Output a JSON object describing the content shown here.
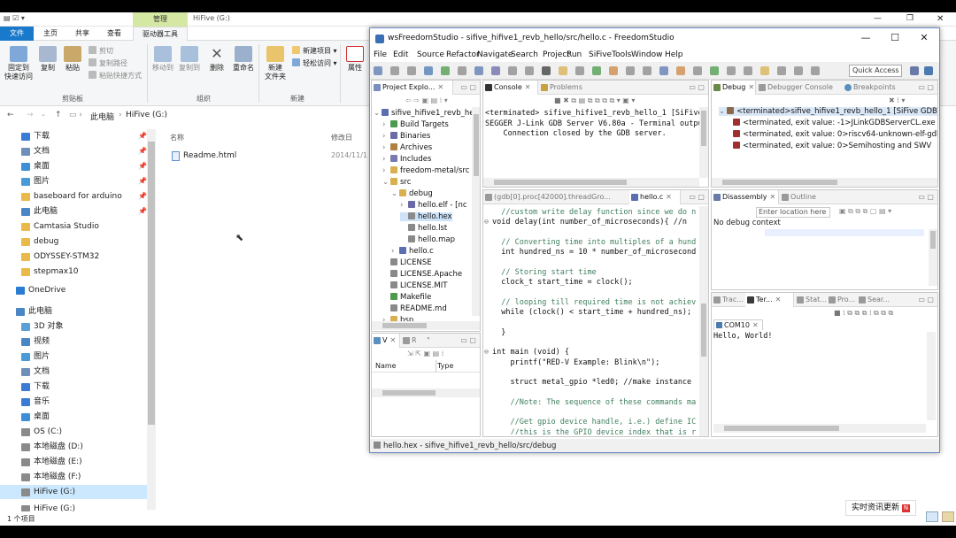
{
  "explorer": {
    "title": "HiFive (G:)",
    "manage_tab": "管理",
    "tabs": [
      "文件",
      "主页",
      "共享",
      "查看",
      "驱动器工具"
    ],
    "ribbon": {
      "pin": "固定到\n快速访问",
      "copy": "复制",
      "paste": "粘贴",
      "cut": "剪切",
      "copy_path": "复制路径",
      "paste_shortcut": "粘贴快捷方式",
      "clipboard_group": "剪贴板",
      "move_to": "移动到",
      "copy_to": "复制到",
      "delete": "删除",
      "rename": "重命名",
      "organize_group": "组织",
      "new_folder": "新建\n文件夹",
      "new_item": "新建项目",
      "easy_access": "轻松访问",
      "new_group": "新建",
      "properties": "属性"
    },
    "address": {
      "pc": "此电脑",
      "drive": "HiFive (G:)"
    },
    "columns": {
      "name": "名称",
      "modified": "修改日"
    },
    "files": [
      {
        "name": "Readme.html",
        "date": "2014/11/1"
      }
    ],
    "nav": [
      {
        "label": "下载",
        "pin": true,
        "color": "#3a7bd5"
      },
      {
        "label": "文档",
        "pin": true,
        "color": "#6e8fb8"
      },
      {
        "label": "桌面",
        "pin": true,
        "color": "#3c8fd6"
      },
      {
        "label": "图片",
        "pin": true,
        "color": "#4b9ad8"
      },
      {
        "label": "baseboard for arduino",
        "pin": true,
        "color": "#e9b949"
      },
      {
        "label": "此电脑",
        "pin": true,
        "color": "#4a86c5"
      },
      {
        "label": "Camtasia Studio",
        "pin": false,
        "color": "#e9b949"
      },
      {
        "label": "debug",
        "pin": false,
        "color": "#e9b949"
      },
      {
        "label": "ODYSSEY-STM32",
        "pin": false,
        "color": "#e9b949"
      },
      {
        "label": "stepmax10",
        "pin": false,
        "color": "#e9b949"
      },
      {
        "label": "OneDrive",
        "pin": false,
        "color": "#2b7cd3"
      },
      {
        "label": "此电脑",
        "pin": false,
        "color": "#4a86c5"
      },
      {
        "label": "3D 对象",
        "pin": false,
        "color": "#5aa0d8"
      },
      {
        "label": "视频",
        "pin": false,
        "color": "#4a86c5"
      },
      {
        "label": "图片",
        "pin": false,
        "color": "#4b9ad8"
      },
      {
        "label": "文档",
        "pin": false,
        "color": "#6e8fb8"
      },
      {
        "label": "下载",
        "pin": false,
        "color": "#3a7bd5"
      },
      {
        "label": "音乐",
        "pin": false,
        "color": "#3a7bd5"
      },
      {
        "label": "桌面",
        "pin": false,
        "color": "#3c8fd6"
      },
      {
        "label": "OS (C:)",
        "pin": false,
        "color": "#8a8a8a"
      },
      {
        "label": "本地磁盘 (D:)",
        "pin": false,
        "color": "#8a8a8a"
      },
      {
        "label": "本地磁盘 (E:)",
        "pin": false,
        "color": "#8a8a8a"
      },
      {
        "label": "本地磁盘 (F:)",
        "pin": false,
        "color": "#8a8a8a"
      },
      {
        "label": "HiFive (G:)",
        "pin": false,
        "color": "#8a8a8a",
        "selected": true
      },
      {
        "label": "HiFive (G:)",
        "pin": false,
        "color": "#8a8a8a"
      }
    ],
    "status": "1 个项目"
  },
  "eclipse": {
    "title": "wsFreedomStudio - sifive_hifive1_revb_hello/src/hello.c - FreedomStudio",
    "menu": [
      "File",
      "Edit",
      "Source",
      "Refactor",
      "Navigate",
      "Search",
      "Project",
      "Run",
      "SiFiveTools",
      "Window",
      "Help"
    ],
    "quick_access": "Quick Access",
    "project_explorer": {
      "tab": "Project Explo...",
      "items": [
        {
          "label": "sifive_hifive1_revb_he",
          "indent": 0,
          "arrow": "⌄",
          "color": "#5b6fb0"
        },
        {
          "label": "Build Targets",
          "indent": 1,
          "arrow": "›",
          "color": "#4c9a4c"
        },
        {
          "label": "Binaries",
          "indent": 1,
          "arrow": "›",
          "color": "#6a6aa8"
        },
        {
          "label": "Archives",
          "indent": 1,
          "arrow": "›",
          "color": "#b08040"
        },
        {
          "label": "Includes",
          "indent": 1,
          "arrow": "›",
          "color": "#7a7ab0"
        },
        {
          "label": "freedom-metal/src",
          "indent": 1,
          "arrow": "›",
          "color": "#d8b050"
        },
        {
          "label": "src",
          "indent": 1,
          "arrow": "⌄",
          "color": "#d8b050"
        },
        {
          "label": "debug",
          "indent": 2,
          "arrow": "⌄",
          "color": "#d8b050"
        },
        {
          "label": "hello.elf - [nc",
          "indent": 3,
          "arrow": "›",
          "color": "#6a6aa8"
        },
        {
          "label": "hello.hex",
          "indent": 3,
          "arrow": "",
          "color": "#8a8a8a",
          "selected": true
        },
        {
          "label": "hello.lst",
          "indent": 3,
          "arrow": "",
          "color": "#8a8a8a"
        },
        {
          "label": "hello.map",
          "indent": 3,
          "arrow": "",
          "color": "#8a8a8a"
        },
        {
          "label": "hello.c",
          "indent": 2,
          "arrow": "›",
          "color": "#5b6fb0"
        },
        {
          "label": "LICENSE",
          "indent": 1,
          "arrow": "",
          "color": "#8a8a8a"
        },
        {
          "label": "LICENSE.Apache",
          "indent": 1,
          "arrow": "",
          "color": "#8a8a8a"
        },
        {
          "label": "LICENSE.MIT",
          "indent": 1,
          "arrow": "",
          "color": "#8a8a8a"
        },
        {
          "label": "Makefile",
          "indent": 1,
          "arrow": "",
          "color": "#4c9a4c"
        },
        {
          "label": "README.md",
          "indent": 1,
          "arrow": "",
          "color": "#8a8a8a"
        },
        {
          "label": "bsp",
          "indent": 1,
          "arrow": "›",
          "color": "#d8b050"
        }
      ]
    },
    "vars": {
      "tabs": [
        "V",
        "R",
        "\""
      ],
      "columns": [
        "Name",
        "Type"
      ]
    },
    "console": {
      "tabs": [
        "Console",
        "Problems"
      ],
      "lines": [
        "<terminated> sifive_hifive1_revb_hello_1 [SiFive GDB SEGGER",
        "SEGGER J-Link GDB Server V6.80a - Terminal outpu",
        "    Connection closed by the GDB server."
      ]
    },
    "editor": {
      "tabs": [
        "(gdb[0].proc[42000].threadGro...",
        "hello.c"
      ],
      "lines": [
        {
          "t": "  //custom write delay function since we do n",
          "c": "cm"
        },
        {
          "t": "void delay(int number_of_microseconds){ //n",
          "c": "code",
          "fold": true
        },
        {
          "t": "",
          "c": "code"
        },
        {
          "t": "  // Converting time into multiples of a hund",
          "c": "cm"
        },
        {
          "t": "  int hundred_ns = 10 * number_of_microsecond",
          "c": "code"
        },
        {
          "t": "",
          "c": "code"
        },
        {
          "t": "  // Storing start time",
          "c": "cm"
        },
        {
          "t": "  clock_t start_time = clock();",
          "c": "code"
        },
        {
          "t": "",
          "c": "code"
        },
        {
          "t": "  // looping till required time is not achiev",
          "c": "cm"
        },
        {
          "t": "  while (clock() < start_time + hundred_ns);",
          "c": "code"
        },
        {
          "t": "",
          "c": "code"
        },
        {
          "t": "  }",
          "c": "code"
        },
        {
          "t": "",
          "c": "code"
        },
        {
          "t": "int main (void) {",
          "c": "code",
          "fold": true
        },
        {
          "t": "    printf(\"RED-V Example: Blink\\n\");",
          "c": "code"
        },
        {
          "t": "",
          "c": "code"
        },
        {
          "t": "    struct metal_gpio *led0; //make instance",
          "c": "code"
        },
        {
          "t": "",
          "c": "code"
        },
        {
          "t": "    //Note: The sequence of these commands ma",
          "c": "cm"
        },
        {
          "t": "",
          "c": "code"
        },
        {
          "t": "    //Get gpio device handle, i.e.) define IC",
          "c": "cm"
        },
        {
          "t": "    //this is the GPIO device index that is r",
          "c": "cm"
        }
      ]
    },
    "debug": {
      "tabs": [
        "Debug",
        "Debugger Console",
        "Breakpoints"
      ],
      "items": [
        "<terminated>sifive_hifive1_revb_hello_1 [SiFive GDB SE",
        "<terminated, exit value: -1>JLinkGDBServerCL.exe",
        "<terminated, exit value: 0>riscv64-unknown-elf-gdb.",
        "<terminated, exit value: 0>Semihosting and SWV"
      ]
    },
    "disassembly": {
      "tabs": [
        "Disassembly",
        "Outline"
      ],
      "placeholder": "Enter location here",
      "status": "No debug context"
    },
    "terminal": {
      "tabs": [
        "Trac...",
        "Ter...",
        "Stat...",
        "Pro...",
        "Sear..."
      ],
      "tab": "COM10",
      "output": "Hello, World!"
    },
    "statusbar": "hello.hex - sifive_hifive1_revb_hello/src/debug"
  },
  "notification": {
    "text": "实时资讯更新"
  }
}
